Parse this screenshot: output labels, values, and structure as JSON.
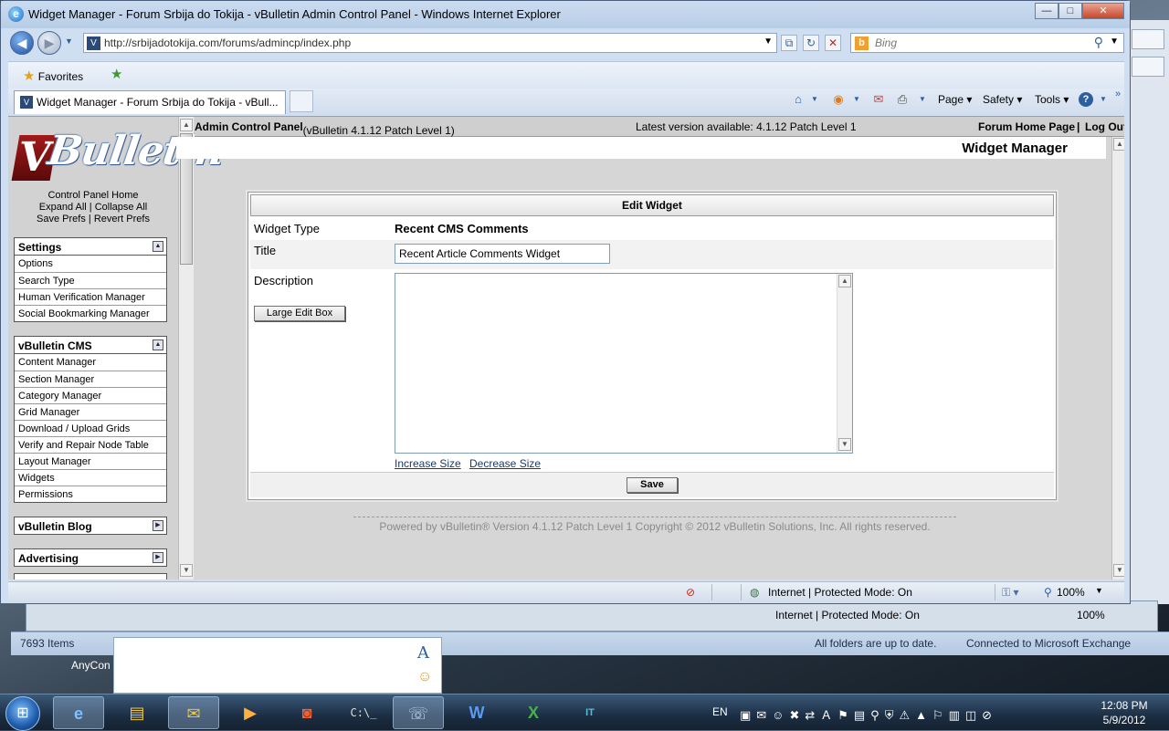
{
  "window": {
    "title": "Widget Manager - Forum Srbija do Tokija - vBulletin Admin Control Panel - Windows Internet Explorer",
    "controls": {
      "minimize": "—",
      "maximize": "□",
      "close": "✕"
    }
  },
  "address_bar": {
    "url": "http://srbijadotokija.com/forums/admincp/index.php",
    "search_placeholder": "Bing"
  },
  "favorites_bar": {
    "favorites_label": "Favorites"
  },
  "tab": {
    "label": "Widget Manager - Forum Srbija do Tokija - vBull..."
  },
  "command_bar": {
    "page": "Page",
    "safety": "Safety",
    "tools": "Tools"
  },
  "sidebar": {
    "control_panel_home": "Control Panel Home",
    "expand_all": "Expand All",
    "collapse_all": "Collapse All",
    "save_prefs": "Save Prefs",
    "revert_prefs": "Revert Prefs",
    "groups": [
      {
        "title": "Settings",
        "items": [
          "Options",
          "Search Type",
          "Human Verification Manager",
          "Social Bookmarking Manager"
        ]
      },
      {
        "title": "vBulletin CMS",
        "items": [
          "Content Manager",
          "Section Manager",
          "Category Manager",
          "Grid Manager",
          "Download / Upload Grids",
          "Verify and Repair Node Table",
          "Layout Manager",
          "Widgets",
          "Permissions"
        ]
      },
      {
        "title": "vBulletin Blog",
        "items": []
      },
      {
        "title": "Advertising",
        "items": []
      }
    ]
  },
  "top_strip": {
    "admin_cp": "Admin Control Panel",
    "version": "(vBulletin 4.1.12 Patch Level 1)",
    "latest": "Latest version available: 4.1.12 Patch Level 1",
    "forum_home": "Forum Home Page",
    "separator": "|",
    "log_out": "Log Out"
  },
  "page": {
    "title": "Widget Manager"
  },
  "form": {
    "header": "Edit Widget",
    "widget_type_label": "Widget Type",
    "widget_type_value": "Recent CMS Comments",
    "title_label": "Title",
    "title_value": "Recent Article Comments Widget",
    "description_label": "Description",
    "large_edit_box": "Large Edit Box",
    "increase_size": "Increase Size",
    "decrease_size": "Decrease Size",
    "save": "Save"
  },
  "footer": {
    "powered": "Powered by vBulletin® Version 4.1.12 Patch Level 1 Copyright © 2012 vBulletin Solutions, Inc. All rights reserved."
  },
  "ie_status": {
    "zone": "Internet | Protected Mode: On",
    "zoom": "100%"
  },
  "bg_window": {
    "zone": "Internet | Protected Mode: On",
    "zoom": "100%"
  },
  "outlook_status": {
    "items": "7693 Items",
    "folders": "All folders are up to date.",
    "exchange": "Connected to Microsoft Exchange",
    "anyconnect": "AnyCon"
  },
  "taskbar": {
    "lang": "EN",
    "time": "12:08 PM",
    "date": "5/9/2012",
    "apps": [
      "Internet Explorer",
      "Windows Explorer",
      "Outlook",
      "Media Player",
      "Presentation",
      "Command Prompt",
      "Communicator",
      "Word",
      "Excel",
      "IT Help"
    ]
  },
  "colors": {
    "titlebar": "#b8cde6",
    "sidebar": "#d2d2d2",
    "content_bg": "#d6d6d6",
    "link": "#1b3a66",
    "taskbar": "#1c2e44"
  }
}
